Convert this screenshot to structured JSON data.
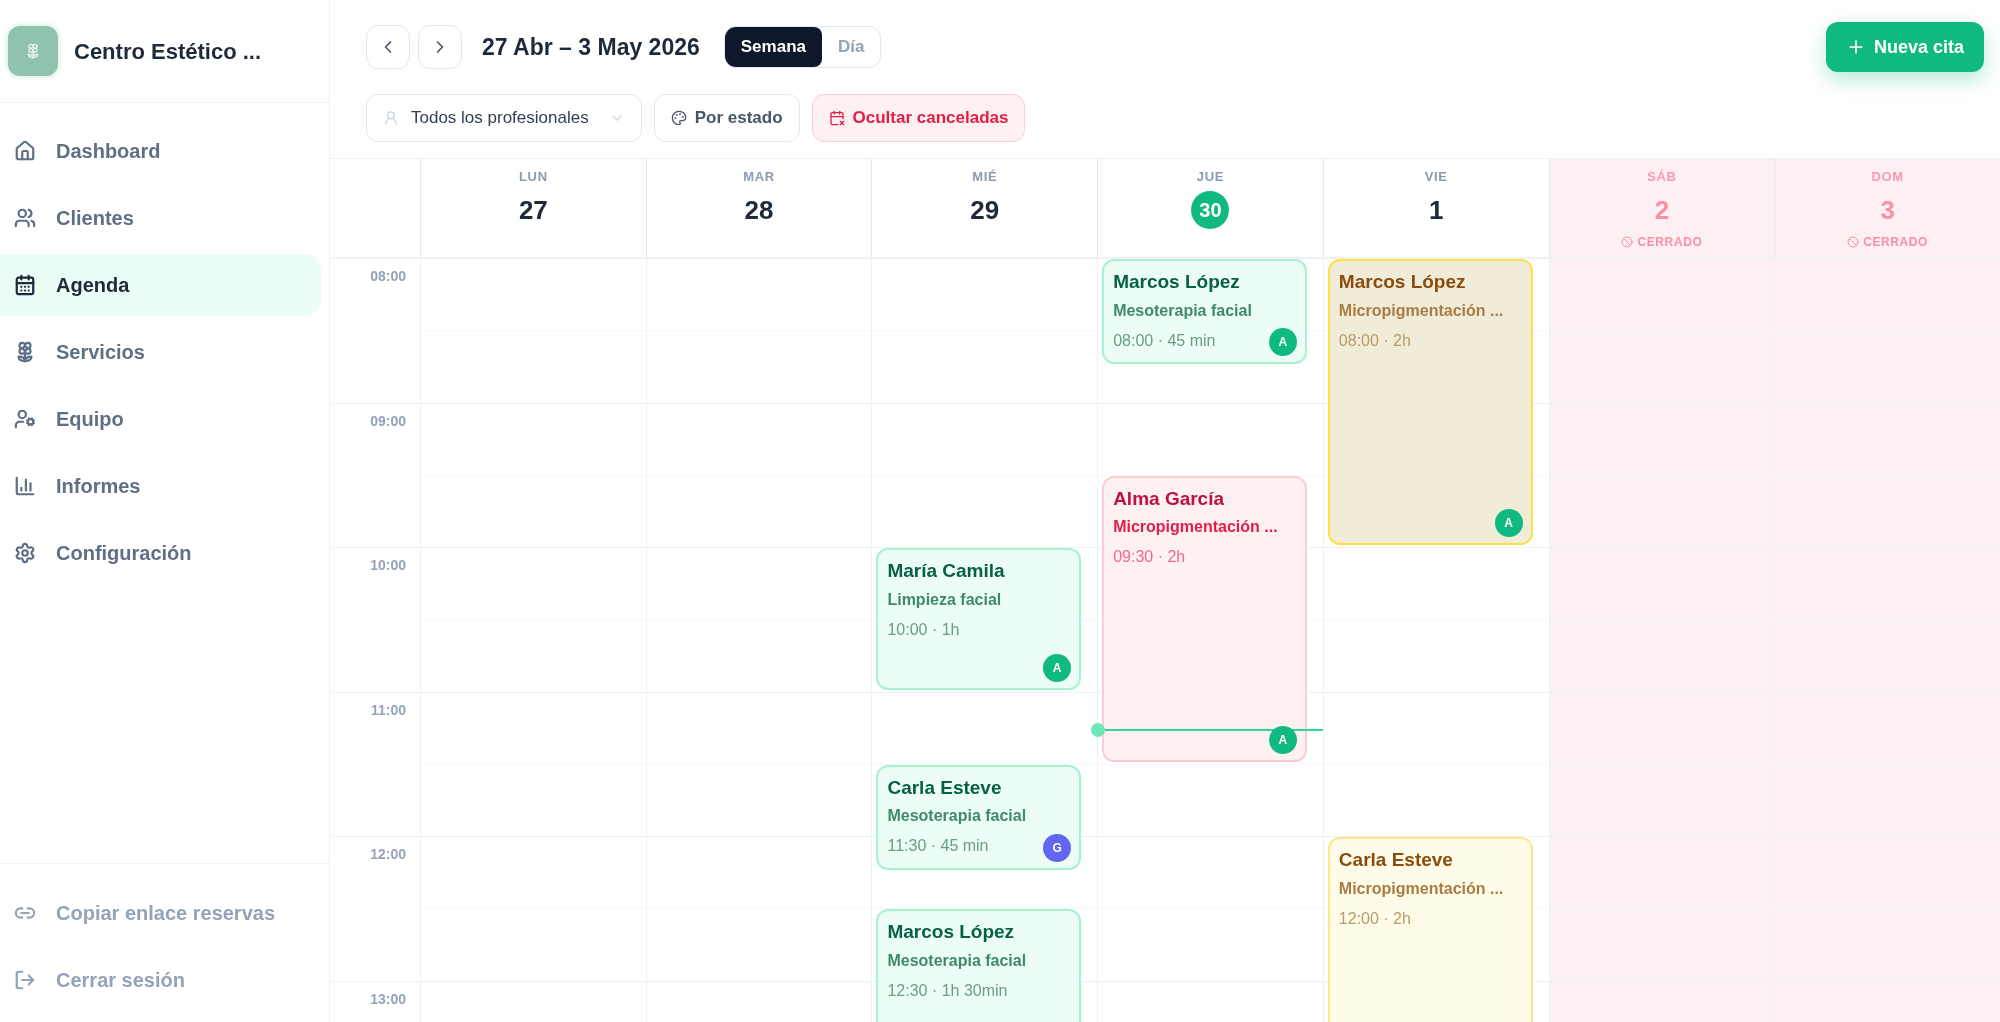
{
  "brand": {
    "name": "Centro Estético ..."
  },
  "sidebar": {
    "items": [
      {
        "label": "Dashboard",
        "selected": false
      },
      {
        "label": "Clientes",
        "selected": false
      },
      {
        "label": "Agenda",
        "selected": true
      },
      {
        "label": "Servicios",
        "selected": false
      },
      {
        "label": "Equipo",
        "selected": false
      },
      {
        "label": "Informes",
        "selected": false
      },
      {
        "label": "Configuración",
        "selected": false
      }
    ],
    "footer_items": [
      {
        "label": "Copiar enlace reservas"
      },
      {
        "label": "Cerrar sesión"
      }
    ]
  },
  "toolbar": {
    "range": "27 Abr – 3 May 2026",
    "views": [
      {
        "label": "Semana",
        "selected": true
      },
      {
        "label": "Día",
        "selected": false
      }
    ],
    "new_button": "Nueva cita",
    "filters": [
      {
        "kind": "dropdown",
        "label": "Todos los profesionales"
      },
      {
        "kind": "palette",
        "label": "Por estado"
      },
      {
        "kind": "danger",
        "label": "Ocultar canceladas"
      }
    ]
  },
  "calendar": {
    "times": [
      "08:00",
      "09:00",
      "10:00",
      "11:00",
      "12:00",
      "13:00"
    ],
    "days": [
      {
        "weekday": "LUN",
        "date": "27",
        "today": false,
        "closed": false
      },
      {
        "weekday": "MAR",
        "date": "28",
        "today": false,
        "closed": false
      },
      {
        "weekday": "MIÉ",
        "date": "29",
        "today": false,
        "closed": false,
        "events": [
          {
            "kind": "confirmed",
            "selected": false,
            "client": "María Camila",
            "service": "Limpieza facial",
            "time": "10:00 · 1h",
            "badge": {
              "text": "A",
              "color": "#10b981"
            }
          },
          {
            "kind": "confirmed",
            "selected": false,
            "client": "Carla Esteve",
            "service": "Mesoterapia facial",
            "time": "11:30 · 45 min",
            "badge": {
              "text": "G",
              "color": "#6366f1"
            }
          },
          {
            "kind": "confirmed",
            "selected": false,
            "client": "Marcos López",
            "service": "Mesoterapia facial",
            "time": "12:30 · 1h 30min"
          }
        ]
      },
      {
        "weekday": "JUE",
        "date": "30",
        "today": true,
        "closed": false,
        "events": [
          {
            "kind": "confirmed",
            "selected": false,
            "client": "Marcos López",
            "service": "Mesoterapia facial",
            "time": "08:00 · 45 min",
            "badge": {
              "text": "A",
              "color": "#10b981"
            }
          },
          {
            "kind": "cancelled",
            "selected": false,
            "client": "Alma García",
            "service": "Micropigmentación ...",
            "time": "09:30 · 2h",
            "badge": {
              "text": "A",
              "color": "#10b981"
            }
          }
        ]
      },
      {
        "weekday": "VIE",
        "date": "1",
        "today": false,
        "closed": false,
        "events": [
          {
            "kind": "pending",
            "selected": true,
            "client": "Marcos López",
            "service": "Micropigmentación ...",
            "time": "08:00 · 2h",
            "badge": {
              "text": "A",
              "color": "#10b981"
            }
          },
          {
            "kind": "pending",
            "selected": false,
            "client": "Carla Esteve",
            "service": "Micropigmentación ...",
            "time": "12:00 · 2h"
          }
        ]
      },
      {
        "weekday": "SÁB",
        "date": "2",
        "today": false,
        "closed": true,
        "closed_label": "CERRADO"
      },
      {
        "weekday": "DOM",
        "date": "3",
        "today": false,
        "closed": true,
        "closed_label": "CERRADO"
      }
    ]
  }
}
